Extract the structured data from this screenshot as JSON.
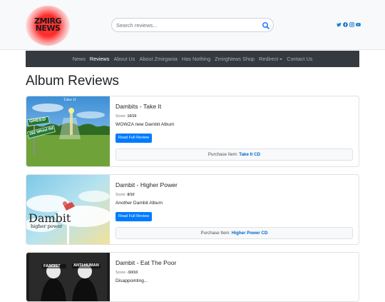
{
  "header": {
    "logo_text_line1": "ZMIRG",
    "logo_text_line2": "NEWS",
    "search_placeholder": "Search reviews...",
    "socials": [
      "twitter-icon",
      "facebook-icon",
      "instagram-icon",
      "youtube-icon"
    ]
  },
  "nav": {
    "items": [
      {
        "label": "News",
        "active": false
      },
      {
        "label": "Reviews",
        "active": true
      },
      {
        "label": "About Us",
        "active": false
      },
      {
        "label": "About Zmirgania",
        "active": false
      },
      {
        "label": "Has Nothing",
        "active": false
      },
      {
        "label": "ZmirgNews Shop",
        "active": false
      },
      {
        "label": "Redirect",
        "active": false,
        "dropdown": true
      },
      {
        "label": "Contact Us",
        "active": false
      }
    ]
  },
  "page": {
    "title": "Album Reviews"
  },
  "reviews": [
    {
      "title": "Dambits - Take It",
      "score_label": "Score:",
      "score": "10/10",
      "description": "WOWZA new Dambit Album",
      "button": "Read Full Review",
      "purchase_label": "Purchase Item:",
      "purchase_link": "Take It CD",
      "cover_text": "Take It",
      "cover_sign_top": "GREED",
      "cover_sign_bottom": "292 Wheel Rd"
    },
    {
      "title": "Dambit - Higher Power",
      "score_label": "Score:",
      "score": "8/10",
      "description": "Another Dambit Album",
      "button": "Read Full Review",
      "purchase_label": "Purchase Item:",
      "purchase_link": "Higher Power CD",
      "cover_text": "Dambit",
      "cover_subtext": "higher power"
    },
    {
      "title": "Dambit - Eat The Poor",
      "score_label": "Score:",
      "score": "-50/10",
      "description": "Disappointing...",
      "cover_label_left": "FASCIST",
      "cover_label_right": "ANTI-HUMAN"
    }
  ],
  "colors": {
    "navbar_bg": "#343a40",
    "primary": "#007bff",
    "link": "#0066cc"
  }
}
